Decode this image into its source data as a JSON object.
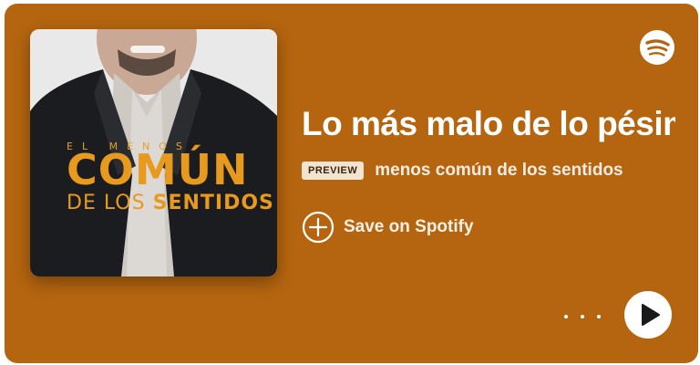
{
  "colors": {
    "card_background": "#b5650f",
    "text_primary": "#ffffff",
    "cover_accent": "#e89a1f"
  },
  "cover": {
    "line_small": "EL MENOS",
    "line_big": "COMÚN",
    "line_sub_a": "DE LOS ",
    "line_sub_b": "SENTIDOS"
  },
  "episode": {
    "title": "Lo más malo de lo pésimo",
    "subtitle": "menos común de los sentidos"
  },
  "badge": {
    "label": "PREVIEW"
  },
  "actions": {
    "save_label": "Save on Spotify"
  },
  "icons": {
    "logo": "spotify-logo-icon",
    "save": "plus-circle-icon",
    "more": "more-options-icon",
    "play": "play-icon"
  }
}
